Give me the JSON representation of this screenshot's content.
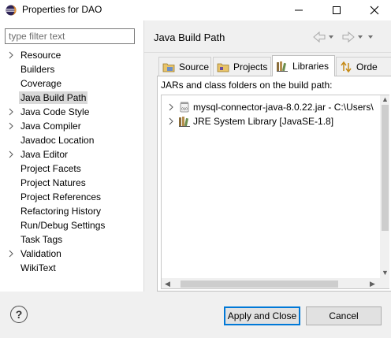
{
  "window": {
    "title": "Properties for DAO",
    "icon": "eclipse-icon",
    "controls": [
      "minimize-icon",
      "maximize-icon",
      "close-icon"
    ]
  },
  "filter": {
    "placeholder": "type filter text",
    "value": ""
  },
  "nav": {
    "items": [
      {
        "label": "Resource",
        "expandable": true
      },
      {
        "label": "Builders",
        "expandable": false
      },
      {
        "label": "Coverage",
        "expandable": false
      },
      {
        "label": "Java Build Path",
        "expandable": false,
        "selected": true
      },
      {
        "label": "Java Code Style",
        "expandable": true
      },
      {
        "label": "Java Compiler",
        "expandable": true
      },
      {
        "label": "Javadoc Location",
        "expandable": false
      },
      {
        "label": "Java Editor",
        "expandable": true
      },
      {
        "label": "Project Facets",
        "expandable": false
      },
      {
        "label": "Project Natures",
        "expandable": false
      },
      {
        "label": "Project References",
        "expandable": false
      },
      {
        "label": "Refactoring History",
        "expandable": false
      },
      {
        "label": "Run/Debug Settings",
        "expandable": false
      },
      {
        "label": "Task Tags",
        "expandable": false
      },
      {
        "label": "Validation",
        "expandable": true
      },
      {
        "label": "WikiText",
        "expandable": false
      }
    ]
  },
  "page": {
    "title": "Java Build Path",
    "nav_icons": [
      "back-arrow-icon",
      "dropdown-icon",
      "forward-arrow-icon",
      "dropdown-icon",
      "view-menu-icon"
    ]
  },
  "tabs": [
    {
      "label": "Source",
      "icon": "source-folder-icon"
    },
    {
      "label": "Projects",
      "icon": "projects-icon"
    },
    {
      "label": "Libraries",
      "icon": "libraries-icon",
      "active": true
    },
    {
      "label": "Orde",
      "icon": "order-export-icon"
    }
  ],
  "libraries": {
    "description": "JARs and class folders on the build path:",
    "entries": [
      {
        "label": "mysql-connector-java-8.0.22.jar - C:\\Users\\",
        "icon": "jar-icon"
      },
      {
        "label": "JRE System Library [JavaSE-1.8]",
        "icon": "jre-library-icon"
      }
    ]
  },
  "footer": {
    "help_label": "?",
    "apply_close_label": "Apply and Close",
    "cancel_label": "Cancel"
  },
  "colors": {
    "accent": "#0078d7",
    "selection": "#d9d9d9",
    "panel": "#f0f0f0",
    "eclipse_purple": "#2c2255",
    "eclipse_orange": "#f7941e"
  }
}
